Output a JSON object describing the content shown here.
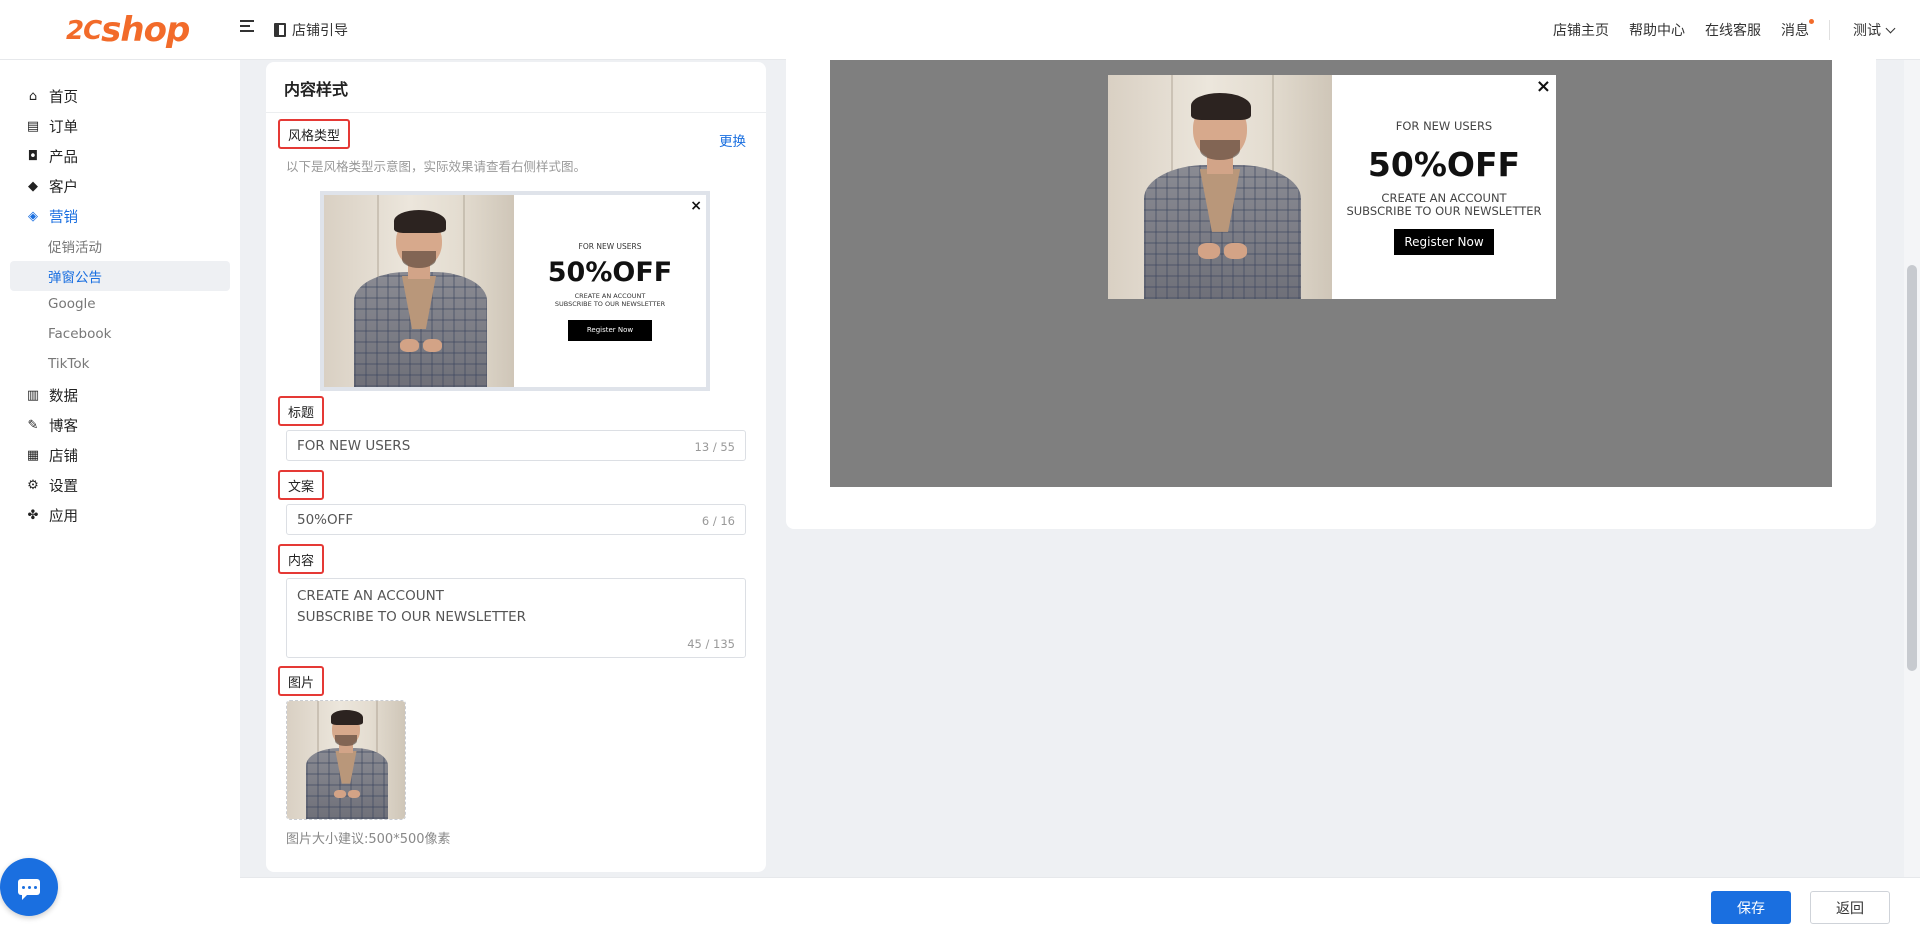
{
  "brand": {
    "logo_prefix": "2C",
    "logo_text": "shop",
    "accent": "#f26b2a"
  },
  "header": {
    "guide_label": "店铺引导",
    "links": [
      "店铺主页",
      "帮助中心",
      "在线客服",
      "消息"
    ],
    "user": "测试"
  },
  "sidebar": {
    "items": [
      {
        "label": "首页",
        "icon": "home-icon"
      },
      {
        "label": "订单",
        "icon": "clipboard-icon"
      },
      {
        "label": "产品",
        "icon": "bag-icon"
      },
      {
        "label": "客户",
        "icon": "diamond-icon"
      },
      {
        "label": "营销",
        "icon": "tag-icon",
        "active": true
      },
      {
        "label": "数据",
        "icon": "bar-chart-icon"
      },
      {
        "label": "博客",
        "icon": "edit-icon"
      },
      {
        "label": "店铺",
        "icon": "store-icon"
      },
      {
        "label": "设置",
        "icon": "gear-icon"
      },
      {
        "label": "应用",
        "icon": "puzzle-icon"
      }
    ],
    "sub_items": [
      {
        "label": "促销活动"
      },
      {
        "label": "弹窗公告",
        "active": true
      },
      {
        "label": "Google"
      },
      {
        "label": "Facebook"
      },
      {
        "label": "TikTok"
      }
    ]
  },
  "form": {
    "title": "内容样式",
    "style_type_label": "风格类型",
    "change_label": "更换",
    "style_hint": "以下是风格类型示意图，实际效果请查看右侧样式图。",
    "title_label": "标题",
    "title_value": "FOR NEW USERS",
    "title_count": "13 / 55",
    "copy_label": "文案",
    "copy_value": "50%OFF",
    "copy_count": "6 / 16",
    "content_label": "内容",
    "content_value": "CREATE AN ACCOUNT\nSUBSCRIBE TO OUR NEWSLETTER",
    "content_count": "45 / 135",
    "image_label": "图片",
    "image_hint": "图片大小建议:500*500像素"
  },
  "popup": {
    "kicker": "FOR NEW USERS",
    "headline": "50%OFF",
    "line1": "CREATE AN ACCOUNT",
    "line2": "SUBSCRIBE TO OUR NEWSLETTER",
    "cta": "Register Now",
    "close": "×"
  },
  "footer": {
    "save_label": "保存",
    "back_label": "返回"
  },
  "colors": {
    "primary": "#1a6fe0",
    "highlight_border": "#e53935",
    "stage_bg": "#7f7f7f"
  }
}
